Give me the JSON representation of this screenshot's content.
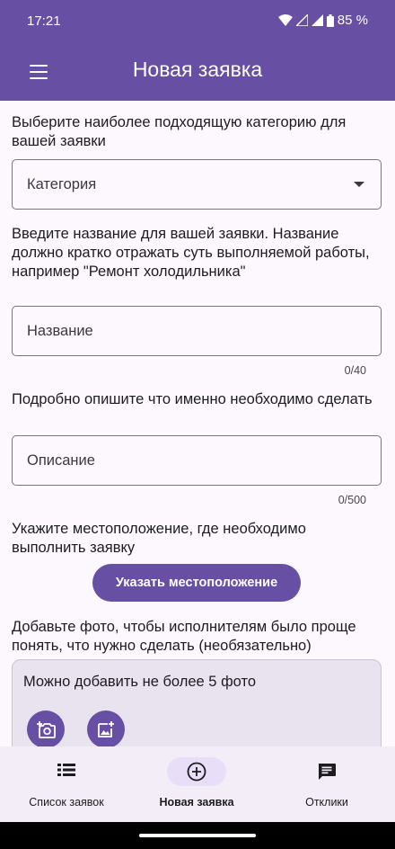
{
  "status_bar": {
    "time": "17:21",
    "battery": "85 %"
  },
  "app_bar": {
    "title": "Новая заявка",
    "menu_icon": "hamburger-menu-icon"
  },
  "form": {
    "category_prompt": "Выберите наиболее подходящую категорию для вашей заявки",
    "category_placeholder": "Категория",
    "name_prompt": "Введите название для вашей заявки. Название должно кратко отражать суть выполняемой работы, например \"Ремонт холодильника\"",
    "name_placeholder": "Название",
    "name_counter": "0/40",
    "description_prompt": "Подробно опишите что именно необходимо сделать",
    "description_placeholder": "Описание",
    "description_counter": "0/500",
    "location_prompt": "Укажите местоположение, где необходимо выполнить заявку",
    "location_button": "Указать местоположение",
    "photo_prompt": "Добавьте фото, чтобы исполнителям было проще понять, что нужно сделать (необязательно)",
    "photo_hint": "Можно добавить не более 5 фото"
  },
  "bottom_nav": [
    {
      "label": "Список заявок",
      "icon": "list-icon",
      "active": false
    },
    {
      "label": "Новая заявка",
      "icon": "add-circle-icon",
      "active": true
    },
    {
      "label": "Отклики",
      "icon": "chat-icon",
      "active": false
    }
  ],
  "colors": {
    "primary": "#6750a4",
    "background": "#fcf8fd",
    "nav_active": "#e8def8"
  }
}
